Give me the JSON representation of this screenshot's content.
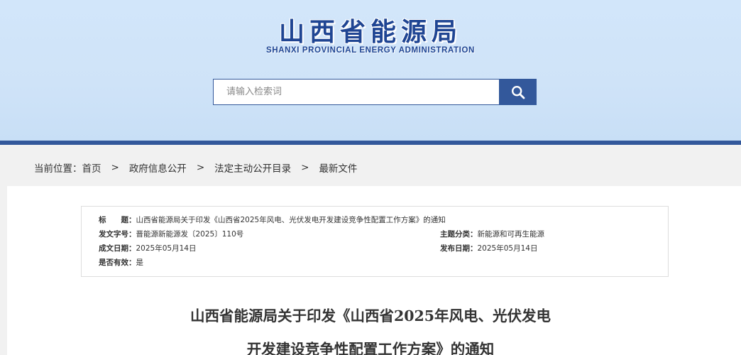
{
  "header": {
    "title_cn": "山西省能源局",
    "title_en": "SHANXI PROVINCIAL ENERGY ADMINISTRATION",
    "brand_color": "#1f4593",
    "accent_color": "#33589b"
  },
  "search": {
    "placeholder": "请输入检索词",
    "button_icon": "search-icon"
  },
  "breadcrumb": {
    "label": "当前位置：",
    "items": [
      "首页",
      "政府信息公开",
      "法定主动公开目录",
      "最新文件"
    ],
    "separator": ">"
  },
  "info": {
    "title_key": "标　　题：",
    "title_value": "山西省能源局关于印发《山西省2025年风电、光伏发电开发建设竞争性配置工作方案》的通知",
    "docno_key": "发文字号：",
    "docno_value": "晋能源新能源发〔2025〕110号",
    "topic_key": "主题分类：",
    "topic_value": "新能源和可再生能源",
    "created_key": "成文日期：",
    "created_value": "2025年05月14日",
    "published_key": "发布日期：",
    "published_value": "2025年05月14日",
    "valid_key": "是否有效：",
    "valid_value": "是"
  },
  "document": {
    "title_line1": "山西省能源局关于印发《山西省2025年风电、光伏发电",
    "title_line2": "开发建设竞争性配置工作方案》的通知"
  }
}
